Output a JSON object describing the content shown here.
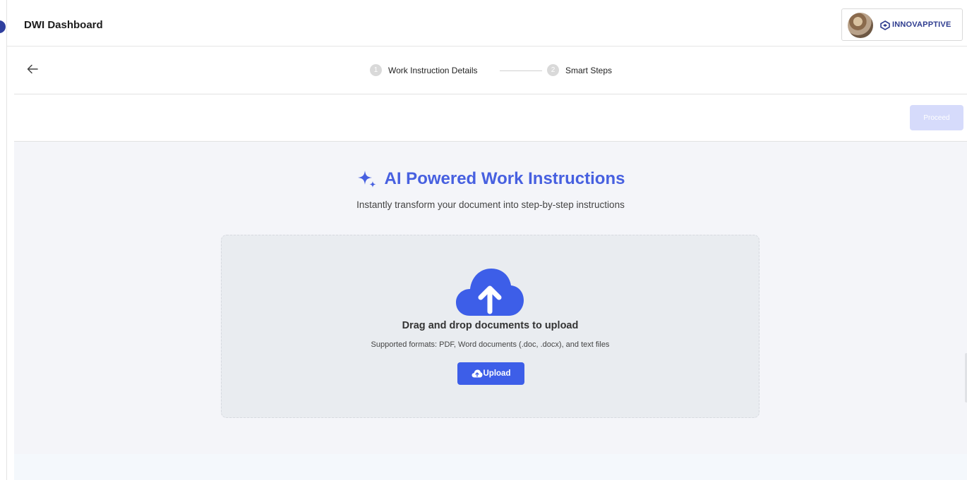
{
  "header": {
    "title": "DWI Dashboard",
    "brand": "INNOVAPPTIVE"
  },
  "stepper": {
    "steps": [
      {
        "number": "1",
        "label": "Work Instruction Details"
      },
      {
        "number": "2",
        "label": "Smart Steps"
      }
    ]
  },
  "actions": {
    "proceed_label": "Proceed"
  },
  "hero": {
    "title": "AI Powered Work Instructions",
    "subtitle": "Instantly transform your document into step-by-step instructions"
  },
  "upload": {
    "title": "Drag and drop documents to upload",
    "formats": "Supported formats: PDF, Word documents (.doc, .docx), and text files",
    "button_label": "Upload"
  },
  "colors": {
    "accent": "#3d5ee8",
    "title": "#4760e0",
    "disabled_button": "#d6dbfb",
    "brand": "#2e3c8f"
  },
  "icons": [
    "back-arrow-icon",
    "sparkle-icon",
    "cloud-upload-icon",
    "brand-logo-icon"
  ]
}
